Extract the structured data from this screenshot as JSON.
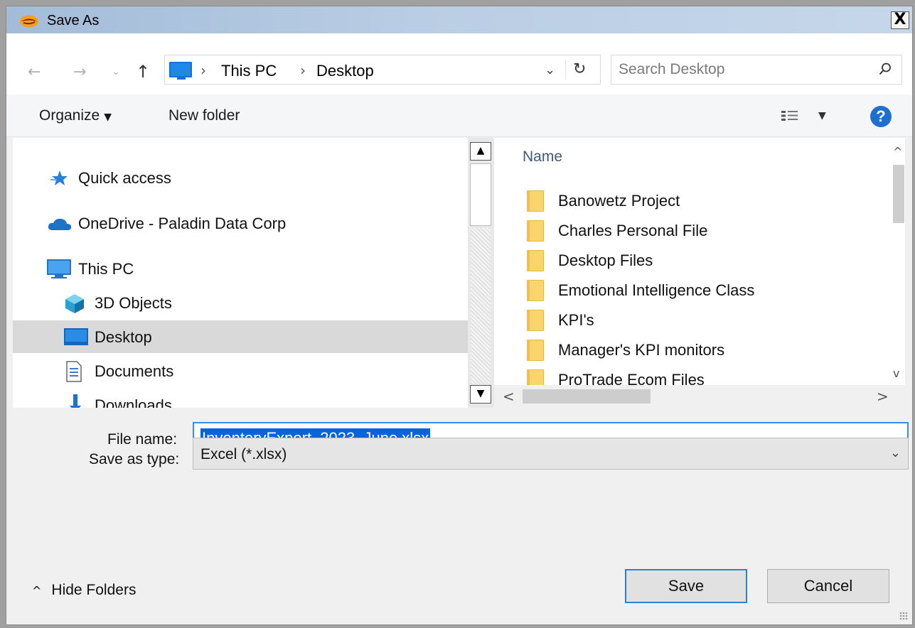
{
  "window": {
    "title": "Save As",
    "close_glyph": "X"
  },
  "nav": {
    "back_glyph": "←",
    "forward_glyph": "→",
    "recent_glyph": "⌄",
    "up_glyph": "↑",
    "breadcrumbs": [
      "This PC",
      "Desktop"
    ],
    "sep_glyph": "›",
    "dropdown_glyph": "⌄",
    "refresh_glyph": "↻"
  },
  "search": {
    "placeholder": "Search Desktop"
  },
  "toolbar": {
    "organize": "Organize",
    "caret": "▼",
    "new_folder": "New folder",
    "help": "?"
  },
  "sidebar": {
    "items": [
      {
        "label": "Quick access",
        "icon": "star-icon"
      },
      {
        "label": "OneDrive - Paladin Data Corp",
        "icon": "cloud-icon"
      },
      {
        "label": "This PC",
        "icon": "computer-icon"
      },
      {
        "label": "3D Objects",
        "icon": "cube-icon"
      },
      {
        "label": "Desktop",
        "icon": "desktop-icon",
        "selected": true
      },
      {
        "label": "Documents",
        "icon": "document-icon"
      },
      {
        "label": "Downloads",
        "icon": "download-icon"
      }
    ]
  },
  "file_list": {
    "column_name": "Name",
    "rows": [
      "Banowetz Project",
      "Charles Personal File",
      "Desktop Files",
      "Emotional Intelligence Class",
      "KPI's",
      "Manager's KPI monitors",
      "ProTrade Ecom Files"
    ]
  },
  "scroll": {
    "up": "▲",
    "down": "▼",
    "up_r": "^",
    "down_r": "v",
    "left": "<",
    "right": ">"
  },
  "form": {
    "file_name_label": "File name:",
    "file_name_value": "InventoryExport_2023_June.xlsx",
    "save_type_label": "Save as type:",
    "save_type_value": "Excel (*.xlsx)",
    "dropdown_glyph": "⌄"
  },
  "footer": {
    "hide_folders": "Hide Folders",
    "hide_caret": "^",
    "save": "Save",
    "cancel": "Cancel"
  },
  "colors": {
    "accent": "#0a64d8",
    "folder": "#f9d66d"
  }
}
